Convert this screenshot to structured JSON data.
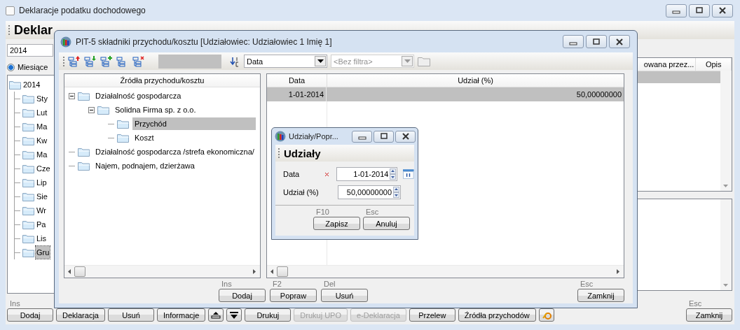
{
  "main_window": {
    "title": "Deklaracje podatku dochodowego",
    "heading": "Deklar",
    "year_field": {
      "value": "2014"
    },
    "period_radio": {
      "label": "Miesiące",
      "selected": true
    },
    "tree": [
      {
        "label": "2014",
        "selected": false,
        "children": [
          {
            "label": "Sty",
            "selected": false
          },
          {
            "label": "Lut",
            "selected": false
          },
          {
            "label": "Ma",
            "selected": false
          },
          {
            "label": "Kw",
            "selected": false
          },
          {
            "label": "Ma",
            "selected": false
          },
          {
            "label": "Cze",
            "selected": false
          },
          {
            "label": "Lip",
            "selected": false
          },
          {
            "label": "Sie",
            "selected": false
          },
          {
            "label": "Wr",
            "selected": false
          },
          {
            "label": "Pa",
            "selected": false
          },
          {
            "label": "Lis",
            "selected": false
          },
          {
            "label": "Gru",
            "selected": true
          }
        ]
      }
    ],
    "table": {
      "columns": [
        "owana przez...",
        "Opis"
      ],
      "rows": [
        {
          "selected": true
        }
      ]
    },
    "buttons": [
      {
        "kind": "text",
        "shortcut": "Ins",
        "label": "Dodaj",
        "disabled": false
      },
      {
        "kind": "text",
        "label": "Deklaracja",
        "disabled": false
      },
      {
        "kind": "text",
        "label": "Usuń",
        "disabled": false
      },
      {
        "kind": "text",
        "label": "Informacje",
        "disabled": false
      },
      {
        "kind": "upload",
        "disabled": false
      },
      {
        "kind": "download",
        "disabled": false
      },
      {
        "kind": "text",
        "label": "Drukuj",
        "disabled": false
      },
      {
        "kind": "text",
        "label": "Drukuj UPO",
        "disabled": true
      },
      {
        "kind": "text",
        "label": "e-Deklaracja",
        "disabled": true
      },
      {
        "kind": "text",
        "label": "Przelew",
        "disabled": false
      },
      {
        "kind": "text",
        "label": "Źródła przychodów",
        "disabled": false
      },
      {
        "kind": "tool",
        "disabled": false
      }
    ],
    "close_button": {
      "shortcut": "Esc",
      "label": "Zamknij"
    }
  },
  "components_window": {
    "title": "PIT-5 składniki przychodu/kosztu [Udziałowiec: Udziałowiec 1 Imię 1]",
    "toolbar": {
      "tools": [
        {
          "kind": "up"
        },
        {
          "kind": "down"
        },
        {
          "kind": "add"
        },
        {
          "kind": "plain"
        },
        {
          "kind": "delete"
        }
      ],
      "sort_field": {
        "value": "Data"
      },
      "filter_field": {
        "placeholder": "<Bez filtra>",
        "disabled": true
      }
    },
    "tree": {
      "header": "Źródła przychodu/kosztu",
      "items": [
        {
          "label": "Działalność gospodarcza",
          "selected": false,
          "expanded": true,
          "children": [
            {
              "label": "Solidna Firma sp. z o.o.",
              "selected": false,
              "expanded": true,
              "children": [
                {
                  "label": "Przychód",
                  "selected": true
                },
                {
                  "label": "Koszt",
                  "selected": false
                }
              ]
            }
          ]
        },
        {
          "label": "Działalność gospodarcza /strefa ekonomiczna/",
          "selected": false
        },
        {
          "label": "Najem, podnajem, dzierżawa",
          "selected": false
        }
      ]
    },
    "grid": {
      "columns": [
        "Data",
        "Udział (%)"
      ],
      "rows": [
        {
          "cells": [
            "1-01-2014",
            "50,00000000"
          ],
          "selected": true
        }
      ]
    },
    "buttons": [
      {
        "shortcut": "Ins",
        "label": "Dodaj"
      },
      {
        "shortcut": "F2",
        "label": "Popraw"
      },
      {
        "shortcut": "Del",
        "label": "Usuń"
      }
    ],
    "close_button": {
      "shortcut": "Esc",
      "label": "Zamknij"
    }
  },
  "shares_dialog": {
    "title": "Udziały/Popr...",
    "heading": "Udziały",
    "fields": [
      {
        "kind": "date",
        "label": "Data",
        "required": true,
        "value": "1-01-2014"
      },
      {
        "kind": "number",
        "label": "Udział (%)",
        "required": false,
        "value": "50,00000000"
      }
    ],
    "buttons": [
      {
        "shortcut": "F10",
        "label": "Zapisz"
      },
      {
        "shortcut": "Esc",
        "label": "Anuluj"
      }
    ]
  }
}
